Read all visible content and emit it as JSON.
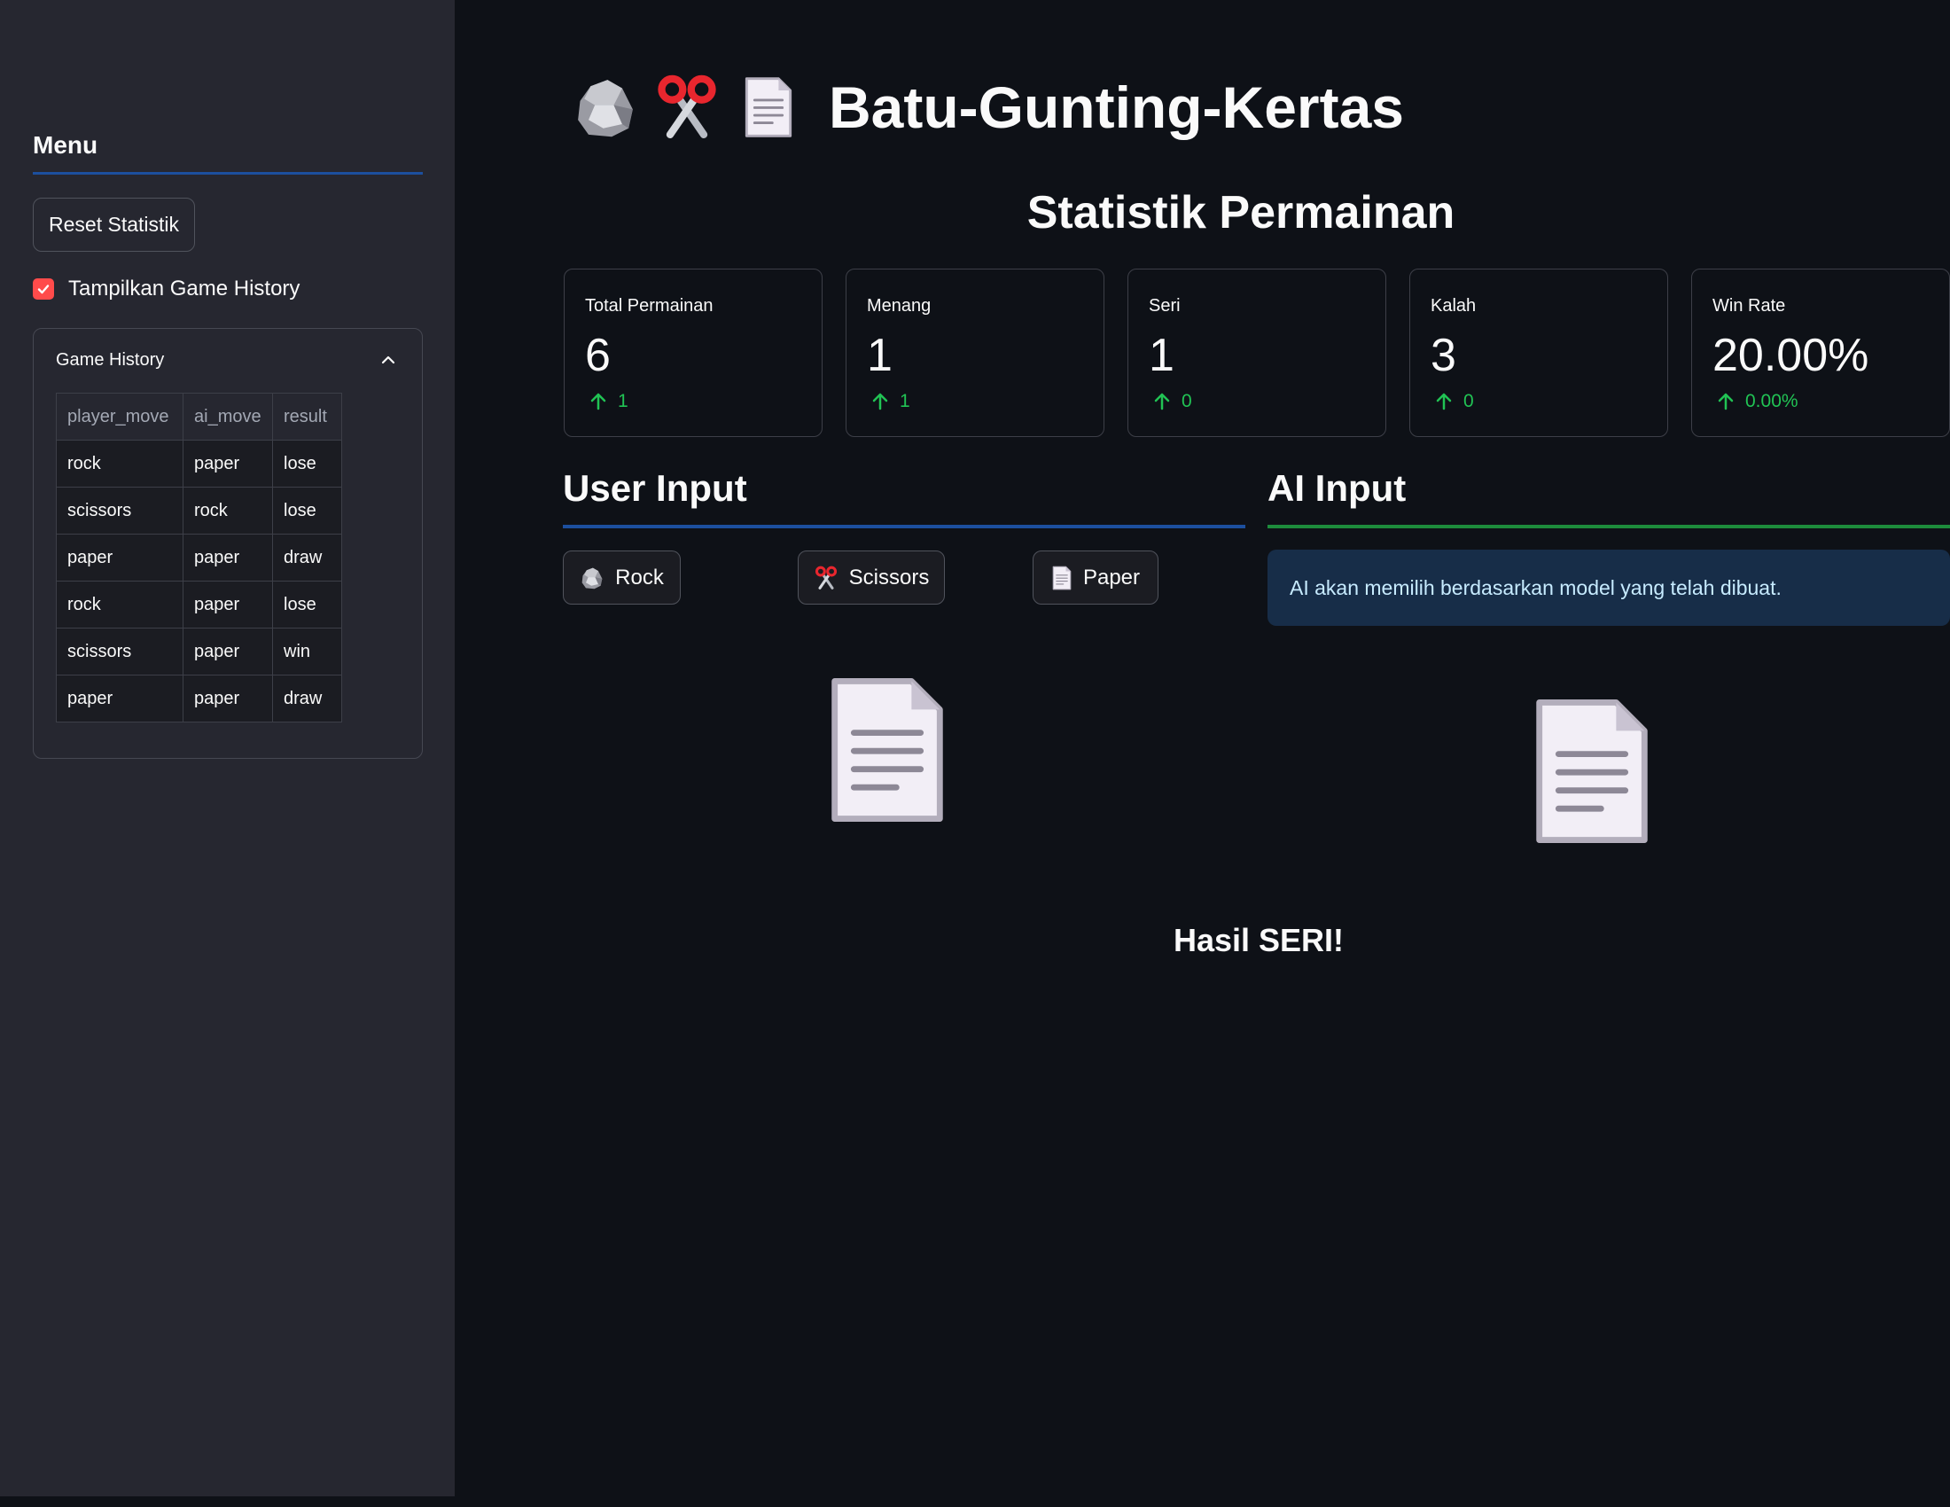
{
  "sidebar": {
    "title": "Menu",
    "reset_button": "Reset Statistik",
    "show_history_label": "Tampilkan Game History",
    "show_history_checked": true,
    "history": {
      "title": "Game History",
      "columns": [
        "player_move",
        "ai_move",
        "result"
      ],
      "rows": [
        [
          "rock",
          "paper",
          "lose"
        ],
        [
          "scissors",
          "rock",
          "lose"
        ],
        [
          "paper",
          "paper",
          "draw"
        ],
        [
          "rock",
          "paper",
          "lose"
        ],
        [
          "scissors",
          "paper",
          "win"
        ],
        [
          "paper",
          "paper",
          "draw"
        ]
      ]
    }
  },
  "header": {
    "title": "Batu-Gunting-Kertas",
    "icons": [
      "rock-icon",
      "scissors-icon",
      "paper-icon"
    ]
  },
  "stats": {
    "title": "Statistik Permainan",
    "metrics": [
      {
        "label": "Total Permainan",
        "value": "6",
        "delta": "1"
      },
      {
        "label": "Menang",
        "value": "1",
        "delta": "1"
      },
      {
        "label": "Seri",
        "value": "1",
        "delta": "0"
      },
      {
        "label": "Kalah",
        "value": "3",
        "delta": "0"
      },
      {
        "label": "Win Rate",
        "value": "20.00%",
        "delta": "0.00%"
      }
    ]
  },
  "user_input": {
    "title": "User Input",
    "buttons": [
      {
        "label": "Rock",
        "icon": "rock-icon"
      },
      {
        "label": "Scissors",
        "icon": "scissors-icon"
      },
      {
        "label": "Paper",
        "icon": "paper-icon"
      }
    ],
    "selected_icon": "paper-icon"
  },
  "ai_input": {
    "title": "AI Input",
    "info": "AI akan memilih berdasarkan model yang telah dibuat.",
    "selected_icon": "paper-icon"
  },
  "result": "Hasil SERI!",
  "colors": {
    "background": "#0e1117",
    "sidebar": "#262730",
    "accent_red": "#ff4b4b",
    "delta_green": "#21c354",
    "info_bg": "#172d48",
    "info_text": "#c7ebff"
  }
}
